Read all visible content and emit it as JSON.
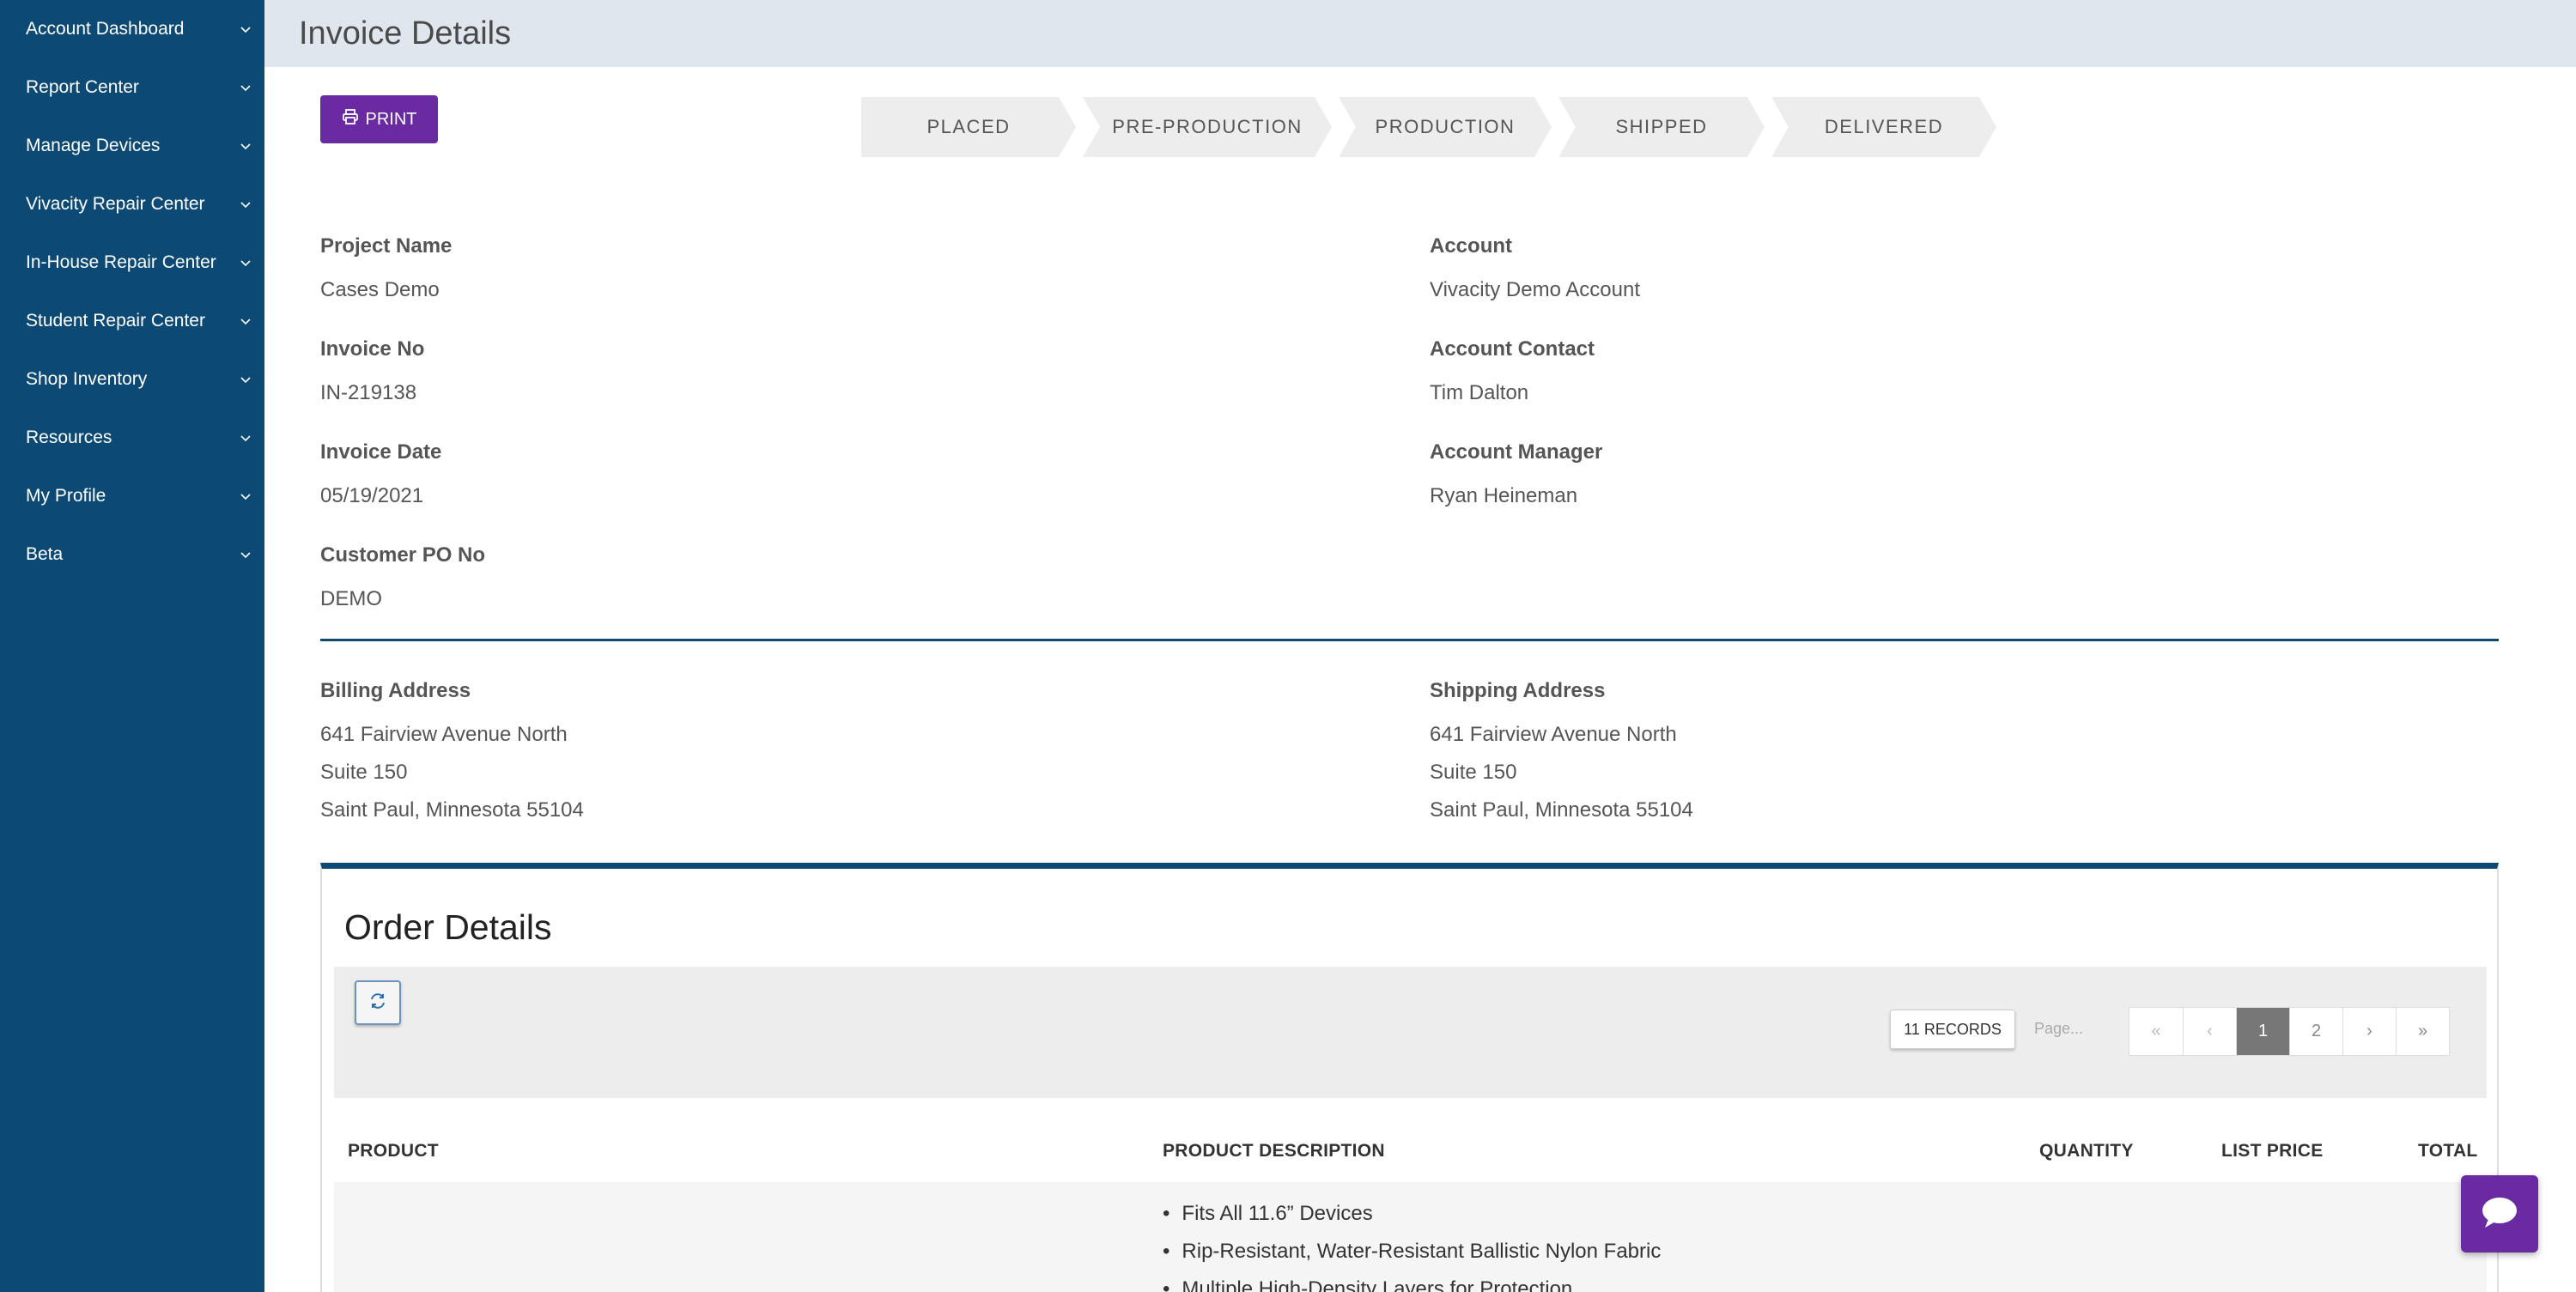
{
  "sidebar": {
    "items": [
      {
        "label": "Account Dashboard"
      },
      {
        "label": "Report Center"
      },
      {
        "label": "Manage Devices"
      },
      {
        "label": "Vivacity Repair Center"
      },
      {
        "label": "In-House Repair Center"
      },
      {
        "label": "Student Repair Center"
      },
      {
        "label": "Shop Inventory"
      },
      {
        "label": "Resources"
      },
      {
        "label": "My Profile"
      },
      {
        "label": "Beta"
      }
    ]
  },
  "header": {
    "title": "Invoice Details"
  },
  "toolbar": {
    "print_label": "PRINT"
  },
  "steps": [
    "PLACED",
    "PRE-PRODUCTION",
    "PRODUCTION",
    "SHIPPED",
    "DELIVERED"
  ],
  "details": {
    "project_name": {
      "label": "Project Name",
      "value": "Cases Demo"
    },
    "invoice_no": {
      "label": "Invoice No",
      "value": "IN-219138"
    },
    "invoice_date": {
      "label": "Invoice Date",
      "value": "05/19/2021"
    },
    "customer_po": {
      "label": "Customer PO No",
      "value": "DEMO"
    },
    "account": {
      "label": "Account",
      "value": "Vivacity Demo Account"
    },
    "account_contact": {
      "label": "Account Contact",
      "value": "Tim Dalton"
    },
    "account_manager": {
      "label": "Account Manager",
      "value": "Ryan Heineman"
    }
  },
  "billing": {
    "label": "Billing Address",
    "line1": "641 Fairview Avenue North",
    "line2": "Suite 150",
    "line3": "Saint Paul, Minnesota 55104"
  },
  "shipping": {
    "label": "Shipping Address",
    "line1": "641 Fairview Avenue North",
    "line2": "Suite 150",
    "line3": "Saint Paul, Minnesota 55104"
  },
  "order": {
    "title": "Order Details",
    "records": "11 RECORDS",
    "page_placeholder": "Page...",
    "pager": [
      "«",
      "‹",
      "1",
      "2",
      "›",
      "»"
    ],
    "columns": {
      "product": "PRODUCT",
      "description": "PRODUCT DESCRIPTION",
      "quantity": "QUANTITY",
      "list_price": "LIST PRICE",
      "total": "TOTAL"
    },
    "rows": [
      {
        "description": [
          "Fits All 11.6” Devices",
          "Rip-Resistant, Water-Resistant Ballistic Nylon Fabric",
          "Multiple High-Density Layers for Protection"
        ]
      }
    ]
  },
  "colors": {
    "sidebar": "#0c4a75",
    "header": "#dfe6ee",
    "accent": "#6a2aa1"
  },
  "icons": {
    "print": "print-icon",
    "refresh": "refresh-icon",
    "chat": "chat-icon",
    "chevron": "chevron-down-icon"
  }
}
